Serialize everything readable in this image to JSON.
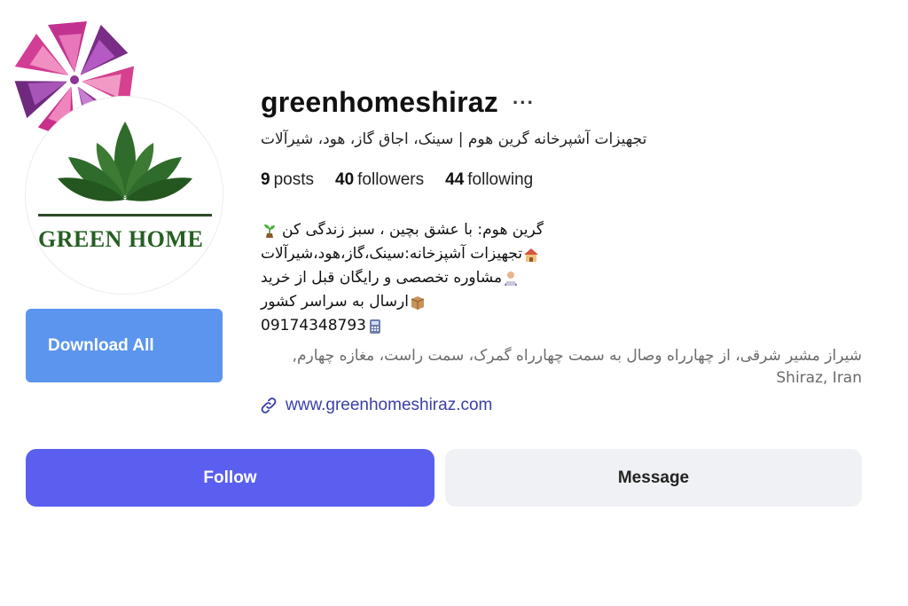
{
  "profile": {
    "username": "greenhomeshiraz",
    "more_label": "···",
    "subtitle": "تجهیزات آشپرخانه گرین هوم | سینک، اجاق گاز، هود، شیرآلات",
    "avatar_brand": "GREEN HOME",
    "stats": {
      "posts_count": "9",
      "posts_label": "posts",
      "followers_count": "40",
      "followers_label": "followers",
      "following_count": "44",
      "following_label": "following"
    },
    "bio": [
      {
        "text": "گرین هوم: با عشق بچین ، سبز زندگی کن",
        "icon": "seedling-icon"
      },
      {
        "text": "تجهیزات آشپزخانه:سینک،گاز،هود،شیرآلات",
        "icon": "house-icon"
      },
      {
        "text": "مشاوره تخصصی و رایگان قبل از خرید",
        "icon": "consultant-icon"
      },
      {
        "text": "ارسال به سراسر کشور",
        "icon": "package-icon"
      },
      {
        "text": "09174348793",
        "icon": "phone-icon"
      }
    ],
    "address": "شیراز مشیر شرقی، از چهارراه وصال به سمت چهارراه گمرک، سمت راست، مغازه چهارم, Shiraz, Iran",
    "website": "www.greenhomeshiraz.com"
  },
  "buttons": {
    "download_all": "Download All",
    "follow": "Follow",
    "message": "Message"
  },
  "colors": {
    "primary": "#5a5ff0",
    "download": "#5b95ee",
    "secondary_bg": "#f0f1f4",
    "link": "#3a3fa8",
    "brand_green": "#245f22"
  }
}
